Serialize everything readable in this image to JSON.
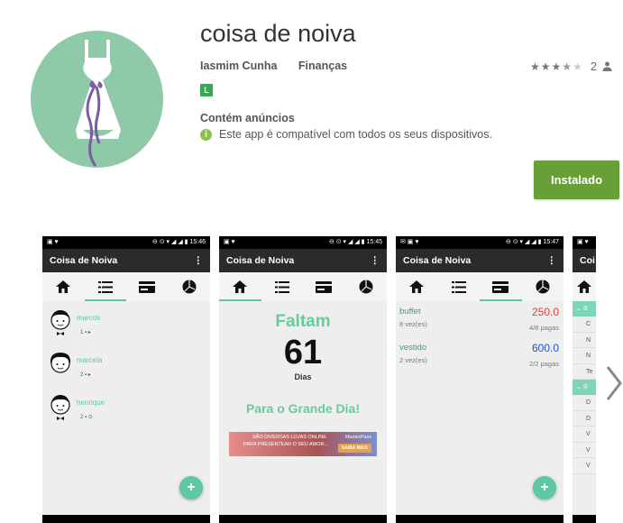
{
  "app": {
    "title": "coisa de noiva",
    "developer": "Iasmim Cunha",
    "category": "Finanças",
    "rating_count": "2",
    "rating_stars": 3.5,
    "content_rating": "L",
    "ads_label": "Contém anúncios",
    "compat_text": "Este app é compatível com todos os seus dispositivos.",
    "install_label": "Instalado"
  },
  "colors": {
    "accent": "#5cc7a3",
    "install": "#689f38",
    "icon_bg": "#8fcaa8",
    "ribbon": "#7b5ca5"
  },
  "screenshots": {
    "s1": {
      "time": "15:46",
      "appbar_title": "Coisa de Noiva",
      "contacts": [
        {
          "name": "marcos",
          "sub": "1"
        },
        {
          "name": "marcela",
          "sub": "2"
        },
        {
          "name": "henrique",
          "sub": "2"
        }
      ],
      "fab": "+"
    },
    "s2": {
      "time": "15:45",
      "appbar_title": "Coisa de Noiva",
      "faltam": "Faltam",
      "days": "61",
      "days_label": "Dias",
      "grande": "Para o Grande Dia!",
      "ad_line1": "SÃO DIVERSAS LOJAS ONLINE",
      "ad_line2": "PARA PRESENTEAR O SEU AMOR...",
      "ad_brand": "MasterPass",
      "ad_btn": "SAIBA MAIS"
    },
    "s3": {
      "time": "15:47",
      "appbar_title": "Coisa de Noiva",
      "expenses": [
        {
          "name": "buffet",
          "amount": "250.0",
          "times": "8 vez(es)",
          "paid": "4/8 pagas"
        },
        {
          "name": "vestido",
          "amount": "600.0",
          "times": "2 vez(es)",
          "paid": "2/2 pagas"
        }
      ],
      "fab": "+"
    },
    "s4": {
      "appbar_title": "Coi",
      "rows": [
        "S",
        "C",
        "N",
        "N",
        "Te",
        "S",
        "D",
        "D",
        "V",
        "V",
        "V"
      ]
    }
  }
}
